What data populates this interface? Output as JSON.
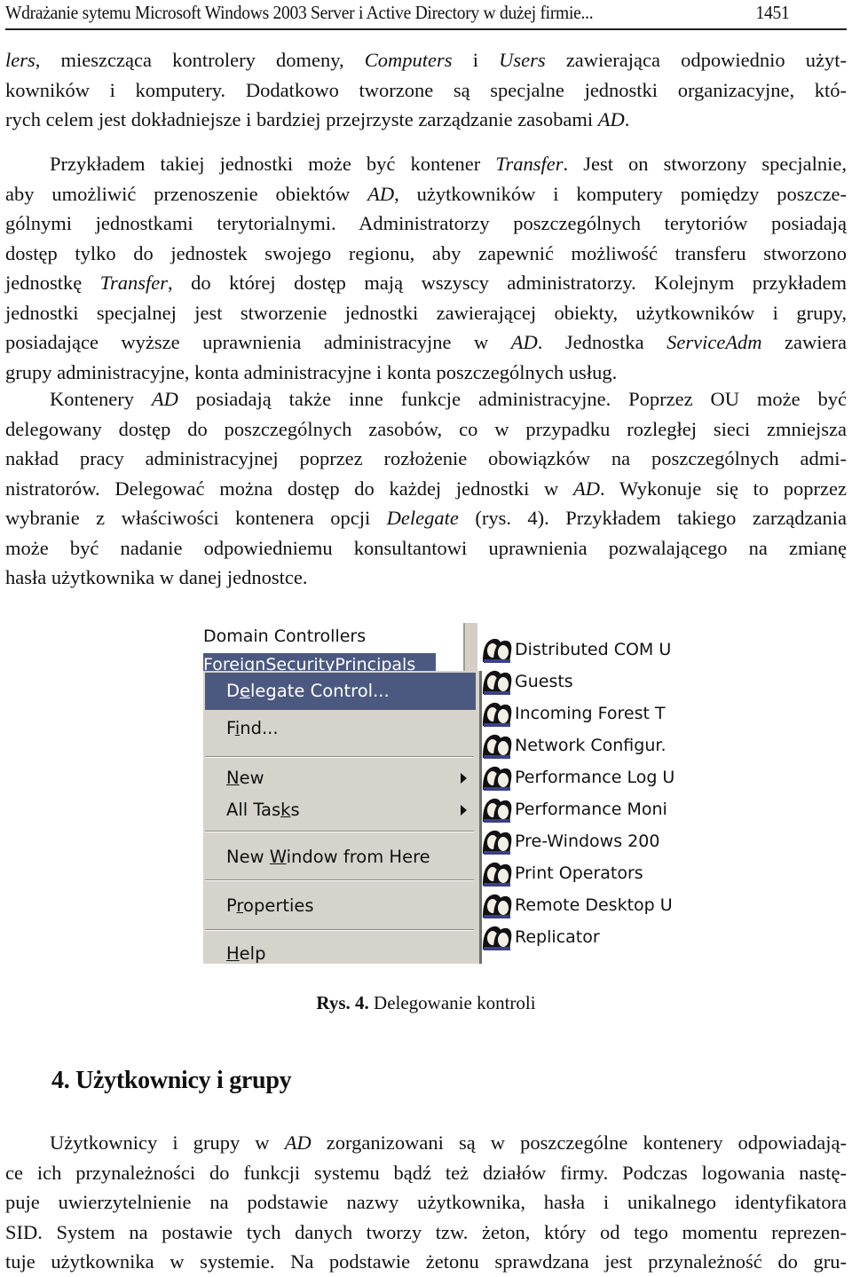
{
  "header": {
    "running_title": "Wdrażanie sytemu Microsoft Windows 2003 Server i Active Directory w dużej firmie...",
    "page_number": "1451"
  },
  "paragraph1": {
    "lines": [
      [
        "",
        "lers",
        ", mieszcząca kontrolery domeny, ",
        "Computers",
        " i ",
        "Users",
        " zawierająca odpowiednio użyt-"
      ],
      [
        "kowników i komputery. Dodatkowo tworzone są specjalne jednostki organizacyjne, któ-"
      ],
      [
        "rych celem jest dokładniejsze i bardziej przejrzyste zarządzanie zasobami ",
        "AD",
        "."
      ]
    ]
  },
  "paragraph2": {
    "lines": [
      [
        "Przykładem takiej jednostki może być kontener ",
        "Transfer",
        ". Jest on stworzony specjalnie,"
      ],
      [
        "aby umożliwić przenoszenie obiektów ",
        "AD",
        ", użytkowników i komputery pomiędzy poszcze-"
      ],
      [
        "gólnymi jednostkami terytorialnymi. Administratorzy poszczególnych terytoriów posiadają"
      ],
      [
        "dostęp tylko do jednostek swojego regionu, aby zapewnić możliwość transferu stworzono"
      ],
      [
        "jednostkę ",
        "Transfer",
        ", do której dostęp mają wszyscy administratorzy. Kolejnym przykładem"
      ],
      [
        "jednostki specjalnej jest stworzenie jednostki zawierającej obiekty, użytkowników i grupy,"
      ],
      [
        "posiadające wyższe uprawnienia administracyjne w ",
        "AD",
        ". Jednostka ",
        "ServiceAdm",
        " zawiera"
      ],
      [
        "grupy administracyjne, konta administracyjne i konta poszczególnych usług."
      ]
    ]
  },
  "paragraph3": {
    "lines": [
      [
        "Kontenery ",
        "AD",
        " posiadają także inne funkcje administracyjne. Poprzez OU może być"
      ],
      [
        "delegowany dostęp do poszczególnych zasobów, co w przypadku rozległej sieci zmniejsza"
      ],
      [
        "nakład pracy administracyjnej poprzez rozłożenie obowiązków na poszczególnych admi-"
      ],
      [
        "nistratorów. Delegować można dostęp do każdej jednostki w ",
        "AD",
        ". Wykonuje się to poprzez"
      ],
      [
        "wybranie z właściwości kontenera opcji ",
        "Delegate",
        " (rys. 4). Przykładem takiego zarządzania"
      ],
      [
        "może być nadanie odpowiedniemu konsultantowi uprawnienia pozwalającego na zmianę"
      ],
      [
        "hasła użytkownika w danej jednostce."
      ]
    ]
  },
  "figure": {
    "tree_items": [
      {
        "label": "Domain Controllers",
        "selected": false
      },
      {
        "label": "ForeignSecurityPrincipals",
        "selected": true
      }
    ],
    "context_menu": [
      {
        "label_pre": "D",
        "label_ul": "e",
        "label_post": "legate Control...",
        "highlight": true,
        "submenu": false
      },
      {
        "label_pre": "F",
        "label_ul": "i",
        "label_post": "nd...",
        "highlight": false,
        "submenu": false
      },
      {
        "separator": true
      },
      {
        "label_pre": "",
        "label_ul": "N",
        "label_post": "ew",
        "highlight": false,
        "submenu": true
      },
      {
        "label_pre": "All Tas",
        "label_ul": "k",
        "label_post": "s",
        "highlight": false,
        "submenu": true
      },
      {
        "separator": true
      },
      {
        "label_pre": "New ",
        "label_ul": "W",
        "label_post": "indow from Here",
        "highlight": false,
        "submenu": false
      },
      {
        "separator": true
      },
      {
        "label_pre": "P",
        "label_ul": "r",
        "label_post": "operties",
        "highlight": false,
        "submenu": false
      },
      {
        "separator": true
      },
      {
        "label_pre": "",
        "label_ul": "H",
        "label_post": "elp",
        "highlight": false,
        "submenu": false
      }
    ],
    "group_list": [
      "Distributed COM U",
      "Guests",
      "Incoming Forest T",
      "Network Configur.",
      "Performance Log U",
      "Performance Moni",
      "Pre-Windows 200",
      "Print Operators",
      "Remote Desktop U",
      "Replicator"
    ],
    "icon": "group-users-icon",
    "colors": {
      "selection": "#4b5880",
      "menu_bg": "#d6d3cc"
    },
    "caption_label": "Rys. 4.",
    "caption_text": " Delegowanie kontroli"
  },
  "section": {
    "heading": "4. Użytkownicy i grupy"
  },
  "paragraph4": {
    "lines": [
      [
        "Użytkownicy i grupy w ",
        "AD",
        " zorganizowani są w poszczególne kontenery odpowiadają-"
      ],
      [
        "ce ich przynależności do funkcji systemu bądź też działów firmy. Podczas logowania nastę-"
      ],
      [
        "puje uwierzytelnienie na podstawie nazwy użytkownika, hasła i unikalnego identyfikatora"
      ],
      [
        "SID. System na postawie tych danych tworzy tzw. żeton, który od tego momentu reprezen-"
      ],
      [
        "tuje użytkownika w systemie. Na podstawie żetonu sprawdzana jest przynależność do gru-"
      ]
    ]
  }
}
